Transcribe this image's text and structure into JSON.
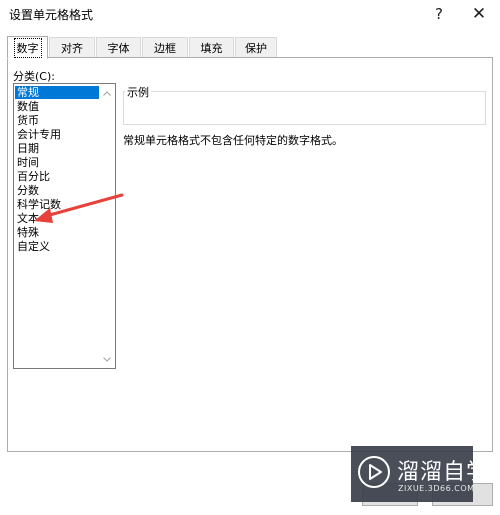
{
  "window": {
    "title": "设置单元格格式",
    "help_label": "?",
    "close_label": "✕"
  },
  "tabs": [
    {
      "label": "数字",
      "active": true
    },
    {
      "label": "对齐",
      "active": false
    },
    {
      "label": "字体",
      "active": false
    },
    {
      "label": "边框",
      "active": false
    },
    {
      "label": "填充",
      "active": false
    },
    {
      "label": "保护",
      "active": false
    }
  ],
  "category": {
    "label": "分类(C):",
    "items": [
      {
        "label": "常规",
        "selected": true
      },
      {
        "label": "数值",
        "selected": false
      },
      {
        "label": "货币",
        "selected": false
      },
      {
        "label": "会计专用",
        "selected": false
      },
      {
        "label": "日期",
        "selected": false
      },
      {
        "label": "时间",
        "selected": false
      },
      {
        "label": "百分比",
        "selected": false
      },
      {
        "label": "分数",
        "selected": false
      },
      {
        "label": "科学记数",
        "selected": false
      },
      {
        "label": "文本",
        "selected": false
      },
      {
        "label": "特殊",
        "selected": false
      },
      {
        "label": "自定义",
        "selected": false
      }
    ]
  },
  "sample": {
    "label": "示例",
    "value": ""
  },
  "description": "常规单元格格式不包含任何特定的数字格式。",
  "annotation": {
    "arrow_color": "#e8413b",
    "points_to": "文本"
  },
  "watermark": {
    "title": "溜溜自学",
    "subtitle": "ZIXUE.3D66.COM"
  },
  "colors": {
    "selection": "#0078d7",
    "watermark_bg": "#3a3f4b"
  }
}
